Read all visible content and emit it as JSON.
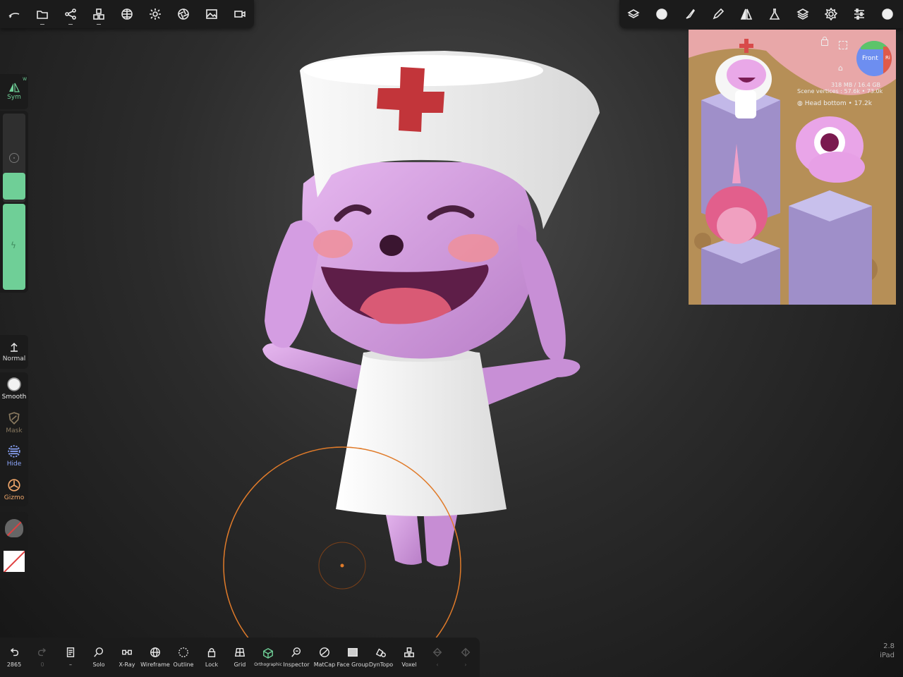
{
  "top_left_tools": [
    {
      "icon": "brush-stroke-icon"
    },
    {
      "icon": "folder-icon"
    },
    {
      "icon": "share-icon"
    },
    {
      "icon": "cubes-icon"
    },
    {
      "icon": "sphere-grid-icon"
    },
    {
      "icon": "sun-icon"
    },
    {
      "icon": "aperture-icon"
    },
    {
      "icon": "image-icon"
    },
    {
      "icon": "camera-icon"
    }
  ],
  "top_right_tools": [
    {
      "icon": "scene-stack-icon"
    },
    {
      "icon": "material-ball-icon"
    },
    {
      "icon": "paint-brush-icon"
    },
    {
      "icon": "pen-icon"
    },
    {
      "icon": "mirror-triangle-icon"
    },
    {
      "icon": "flask-icon"
    },
    {
      "icon": "layers-icon"
    },
    {
      "icon": "settings-icon"
    },
    {
      "icon": "sliders-icon"
    },
    {
      "icon": "sphere-icon"
    }
  ],
  "left": {
    "sym_label": "Sym",
    "sym_badge": "W",
    "normal_label": "Normal",
    "tools": [
      {
        "label": "Smooth",
        "icon": "smooth-ball-icon",
        "color": "#ffffff"
      },
      {
        "label": "Mask",
        "icon": "mask-shield-icon",
        "color": "#8a7a60"
      },
      {
        "label": "Hide",
        "icon": "hide-grid-icon",
        "color": "#8ea8ff"
      },
      {
        "label": "Gizmo",
        "icon": "gizmo-icon",
        "color": "#f2a86b"
      }
    ]
  },
  "bottom_tools": [
    {
      "label": "2865",
      "icon": "undo-icon"
    },
    {
      "label": "0",
      "icon": "redo-icon",
      "dim": true
    },
    {
      "label": "–",
      "icon": "history-icon"
    },
    {
      "label": "Solo",
      "icon": "search-icon"
    },
    {
      "label": "X-Ray",
      "icon": "glasses-icon"
    },
    {
      "label": "Wireframe",
      "icon": "wire-sphere-icon"
    },
    {
      "label": "Outline",
      "icon": "dotted-circle-icon"
    },
    {
      "label": "Lock",
      "icon": "lock-icon"
    },
    {
      "label": "Grid",
      "icon": "grid-plane-icon"
    },
    {
      "label": "Orthographic",
      "icon": "ortho-cube-icon",
      "small": true
    },
    {
      "label": "Inspector",
      "icon": "inspect-icon"
    },
    {
      "label": "MatCap",
      "icon": "matcap-icon"
    },
    {
      "label": "Face Group",
      "icon": "face-group-icon"
    },
    {
      "label": "DynTopo",
      "icon": "dyntopo-icon"
    },
    {
      "label": "Voxel",
      "icon": "voxel-icon"
    },
    {
      "label": "‹",
      "icon": "multires-down-icon",
      "dim": true
    },
    {
      "label": "›",
      "icon": "multires-up-icon",
      "dim": true
    }
  ],
  "reference": {
    "memory": "318 MB / 16.4 GB",
    "vertices": "Scene vertices : 57.6k • 73.0k",
    "selected": "Head bottom • 17.2k",
    "view_cube": "Front",
    "view_cube_side": "Ri"
  },
  "version": {
    "number": "2.8",
    "platform": "iPad"
  },
  "colors": {
    "skin": "#d9a0e6",
    "hat": "#f3f3f3",
    "cross": "#c2353a",
    "brush": "#e07b2a",
    "accent_green": "#6fcf97"
  }
}
